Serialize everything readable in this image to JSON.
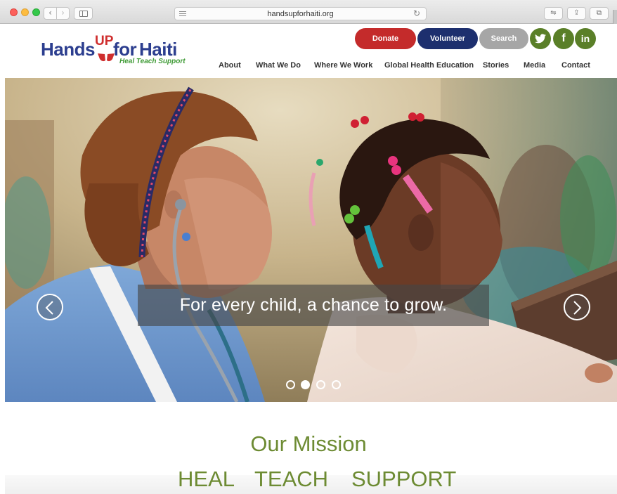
{
  "browser": {
    "url": "handsupforhaiti.org"
  },
  "logo": {
    "hands": "Hands",
    "up": "UP",
    "for": "for",
    "haiti": "Haiti",
    "tagline": "Heal Teach Support"
  },
  "header_buttons": {
    "donate": "Donate",
    "volunteer": "Volunteer",
    "search": "Search"
  },
  "social": {
    "twitter_icon": "twitter-icon",
    "facebook": "f",
    "linkedin": "in"
  },
  "nav": {
    "items": [
      {
        "label": "About"
      },
      {
        "label": "What We Do"
      },
      {
        "label": "Where We Work"
      },
      {
        "label": "Global Health Education"
      },
      {
        "label": "Stories"
      },
      {
        "label": "Media"
      },
      {
        "label": "Contact"
      }
    ]
  },
  "hero": {
    "caption": "For every child, a chance to grow.",
    "slide_count": 4,
    "active_slide": 2
  },
  "mission": {
    "title": "Our Mission",
    "pillars": [
      "HEAL",
      "TEACH",
      "SUPPORT"
    ]
  },
  "colors": {
    "brand_blue": "#2c3e8f",
    "brand_red": "#c42b2b",
    "brand_green": "#6d8b33",
    "volunteer_navy": "#1d2f6e",
    "search_gray": "#a6a6a6"
  }
}
